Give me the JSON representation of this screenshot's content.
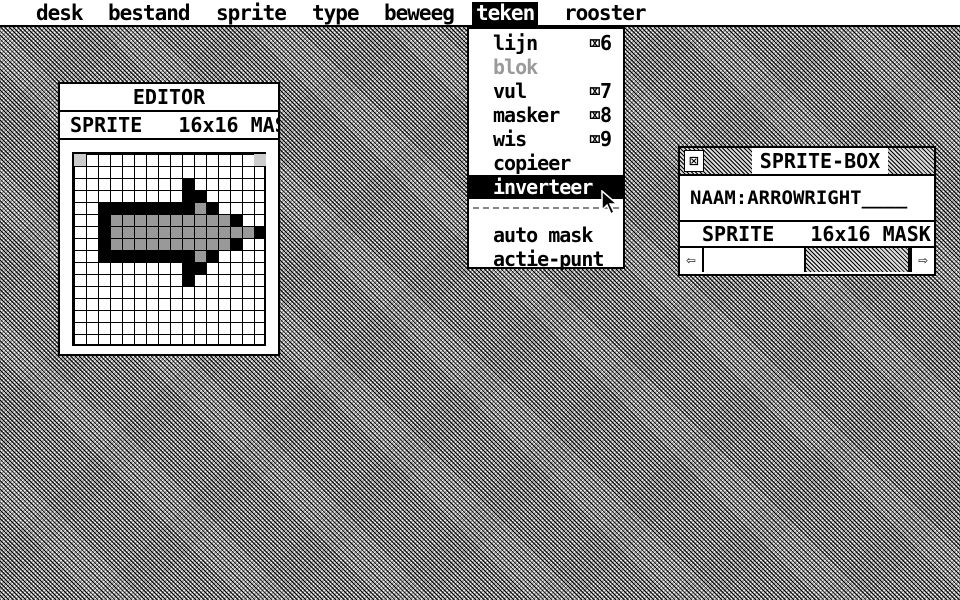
{
  "menubar": {
    "items": [
      {
        "label": "desk"
      },
      {
        "label": "bestand"
      },
      {
        "label": "sprite"
      },
      {
        "label": "type"
      },
      {
        "label": "beweeg"
      },
      {
        "label": "teken"
      },
      {
        "label": "rooster"
      }
    ],
    "active_item": "teken"
  },
  "teken_menu": {
    "items": [
      {
        "label": "lijn",
        "shortcut": "⌧6",
        "enabled": true
      },
      {
        "label": "blok",
        "shortcut": "",
        "enabled": false
      },
      {
        "label": "vul",
        "shortcut": "⌧7",
        "enabled": true
      },
      {
        "label": "masker",
        "shortcut": "⌧8",
        "enabled": true
      },
      {
        "label": "wis",
        "shortcut": "⌧9",
        "enabled": true
      },
      {
        "label": "copieer",
        "shortcut": "",
        "enabled": true
      },
      {
        "label": "inverteer",
        "shortcut": "",
        "enabled": true,
        "selected": true
      },
      {
        "label": "auto mask",
        "shortcut": "",
        "enabled": true
      },
      {
        "label": "actie-punt",
        "shortcut": "",
        "enabled": true
      }
    ]
  },
  "editor": {
    "title": "EDITOR",
    "info": "SPRITE   16x16 MAS",
    "grid_size": "16x16"
  },
  "sprite_box": {
    "close_icon": "⊠",
    "title": "SPRITE-BOX",
    "name_line": "NAAM:ARROWRIGHT____",
    "info": "SPRITE   16x16 MASK",
    "scroll_left_icon": "⇦",
    "scroll_right_icon": "⇨"
  },
  "colors": {
    "foreground": "#000000",
    "background": "#ffffff",
    "desktop_pattern": "#9a9a9a"
  }
}
